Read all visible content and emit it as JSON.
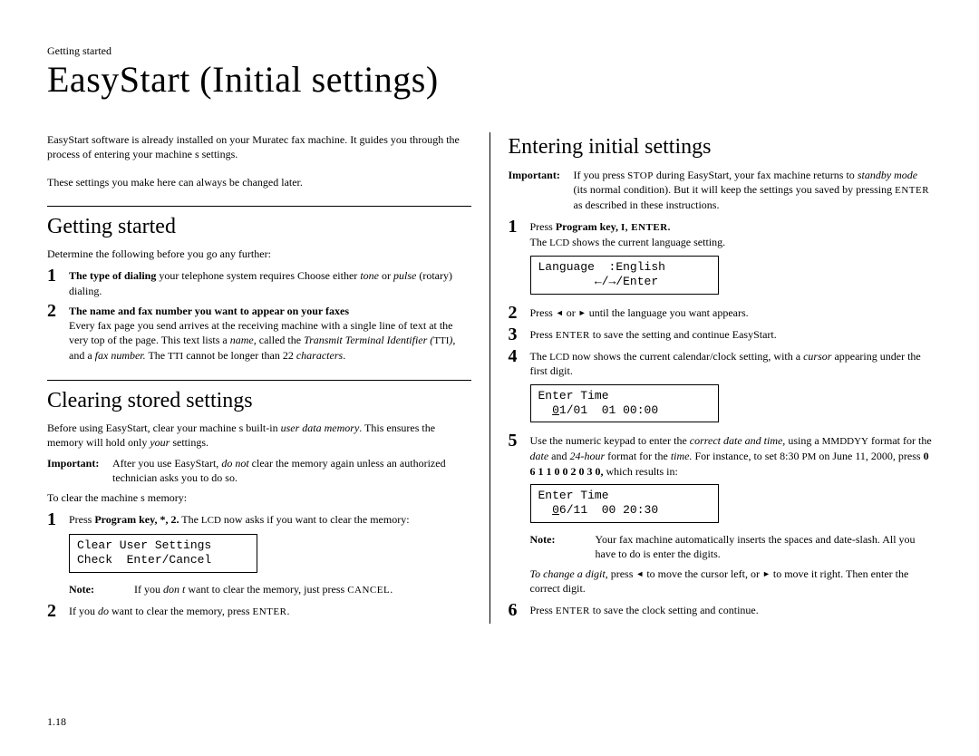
{
  "running_head": "Getting started",
  "title": "EasyStart (Initial settings)",
  "intro_lines": [
    "EasyStart software is already installed on your Muratec fax machine. It guides you through the process of entering your machine s settings.",
    "These settings you make here can always be changed later."
  ],
  "left": {
    "sec1": {
      "heading": "Getting started",
      "lead": "Determine the following before you go any further:",
      "items": [
        {
          "num": "1",
          "lead_bold": "The type of dialing",
          "lead_rest": " your telephone system requires   Choose either ",
          "tone": "tone",
          "mid": " or ",
          "pulse": "pulse",
          "tail": " (rotary) dialing."
        },
        {
          "num": "2",
          "lead_bold": "The name and fax number you want to appear on your faxes",
          "body1": "Every fax page you send arrives at the receiving machine with a single line of text at the very top of the page. This text lists a ",
          "name_em": "name,",
          "body2": " called the ",
          "tti_em": "Transmit Terminal Identifier (",
          "tti_sc": "TTI",
          "tti_close": "),",
          "body3": " and a ",
          "fax_em": "fax number.",
          "body4": " The ",
          "tti_sc2": "TTI",
          "body5": " cannot be longer than 22 ",
          "chars_em": "characters",
          "period": "."
        }
      ]
    },
    "sec2": {
      "heading": "Clearing stored settings",
      "p1a": "Before using EasyStart, clear your machine s built-in ",
      "p1em": "user data memory",
      "p1b": ". This ensures the memory will hold only ",
      "p1em2": "your",
      "p1c": " settings.",
      "imp_label": "Important:",
      "imp_a": "After you use EasyStart, ",
      "imp_em": "do not",
      "imp_b": " clear the memory again unless an authorized technician asks you to do so.",
      "toclear": "To clear the machine s memory:",
      "step1_num": "1",
      "step1_a": "Press ",
      "step1_b": "Program key, *, 2.",
      "step1_c": " The ",
      "step1_sc": "LCD",
      "step1_d": " now asks if you want to clear the memory:",
      "lcd1": "Clear User Settings\nCheck  Enter/Cancel",
      "note1_label": "Note:",
      "note1_a": "If you ",
      "note1_em": "don t",
      "note1_b": " want to clear the memory, just press ",
      "note1_sc": "CANCEL",
      "note1_c": ".",
      "step2_num": "2",
      "step2_a": "If you ",
      "step2_em": "do",
      "step2_b": " want to clear the memory, press ",
      "step2_sc": "ENTER",
      "step2_c": "."
    }
  },
  "right": {
    "heading": "Entering initial settings",
    "imp_label": "Important:",
    "imp_a": "If you press ",
    "imp_sc1": "STOP",
    "imp_b": " during EasyStart, your fax machine returns to ",
    "imp_em": "standby mode",
    "imp_c": " (its normal condition). But it will keep the settings you saved by pressing ",
    "imp_sc2": "ENTER",
    "imp_d": " as described in these instructions.",
    "s1_num": "1",
    "s1_a": "Press ",
    "s1_b": "Program key, ",
    "s1_sc": "I, ENTER.",
    "s1_line2a": "The ",
    "s1_line2sc": "LCD",
    "s1_line2b": " shows the current language setting.",
    "lcd_lang": "Language  :English\n        ←/→/Enter",
    "s2_num": "2",
    "s2_a": "Press ",
    "s2_b": " or ",
    "s2_c": " until the language you want appears.",
    "s3_num": "3",
    "s3_a": "Press ",
    "s3_sc": "ENTER",
    "s3_b": " to save the setting and continue EasyStart.",
    "s4_num": "4",
    "s4_a": "The ",
    "s4_sc": "LCD",
    "s4_b": " now shows the current calendar/clock setting, with a ",
    "s4_em": "cursor",
    "s4_c": " appearing under the first digit.",
    "lcd_time1": "Enter Time\n  01/01  01 00:00",
    "lcd_time1_u": "0",
    "lcd_time1_rest": "1/01  01 00:00",
    "s5_num": "5",
    "s5_a": "Use the numeric keypad to enter the ",
    "s5_em1": "correct date and time,",
    "s5_b": " using a ",
    "s5_sc1": "MMDDYY",
    "s5_c": " format for the ",
    "s5_em2": "date",
    "s5_d": " and ",
    "s5_em3": "24-hour",
    "s5_e": " format for the ",
    "s5_em4": "time.",
    "s5_f": " For instance, to set 8:30 ",
    "s5_sc2": "PM",
    "s5_g": " on June 11, 2000, press ",
    "s5_bold": "0 6 1 1 0 0 2 0 3 0,",
    "s5_h": " which results in:",
    "lcd_time2_line1": "Enter Time",
    "lcd_time2_u": "0",
    "lcd_time2_rest": "6/11  00 20:30",
    "note2_label": "Note:",
    "note2_txt": "Your fax machine automatically inserts the spaces and date-slash. All you have to do is enter the digits.",
    "change_a": "To change a digit,",
    "change_b": " press ",
    "change_c": " to move the cursor left, or ",
    "change_d": " to move it right. Then enter the correct digit.",
    "s6_num": "6",
    "s6_a": "Press ",
    "s6_sc": "ENTER",
    "s6_b": " to save the clock setting and continue."
  },
  "page_num": "1.18"
}
